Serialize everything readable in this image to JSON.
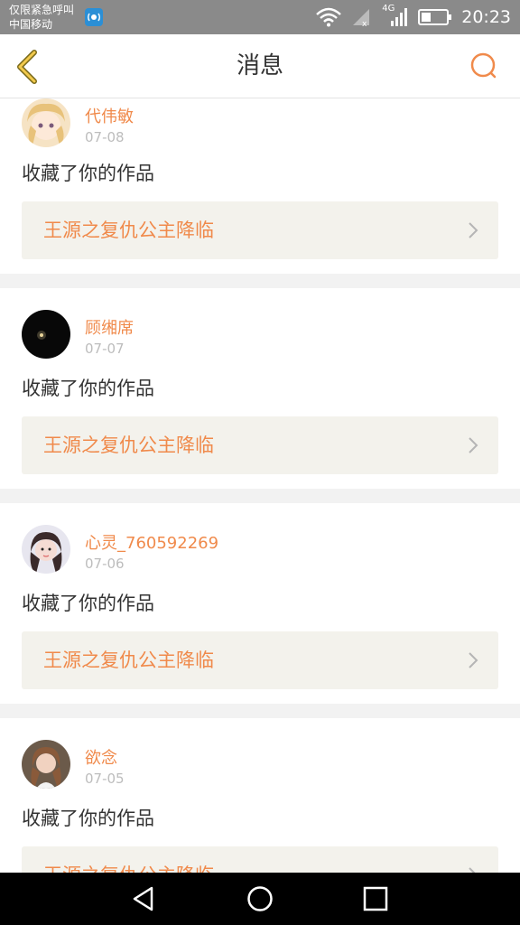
{
  "status_bar": {
    "line1": "仅限紧急呼叫",
    "line2": "中国移动",
    "network": "4G",
    "time": "20:23"
  },
  "header": {
    "title": "消息",
    "back_icon": "chevron-left-icon",
    "search_icon": "search-icon"
  },
  "accent_color": "#f08a4b",
  "messages": [
    {
      "user": "代伟敏",
      "date": "07-08",
      "action": "收藏了你的作品",
      "work": "王源之复仇公主降临"
    },
    {
      "user": "顾缃席",
      "date": "07-07",
      "action": "收藏了你的作品",
      "work": "王源之复仇公主降临"
    },
    {
      "user": "心灵_760592269",
      "date": "07-06",
      "action": "收藏了你的作品",
      "work": "王源之复仇公主降临"
    },
    {
      "user": "欲念",
      "date": "07-05",
      "action": "收藏了你的作品",
      "work": "王源之复仇公主降临"
    }
  ],
  "nav_bar": [
    "back-triangle-icon",
    "home-circle-icon",
    "recents-square-icon"
  ]
}
